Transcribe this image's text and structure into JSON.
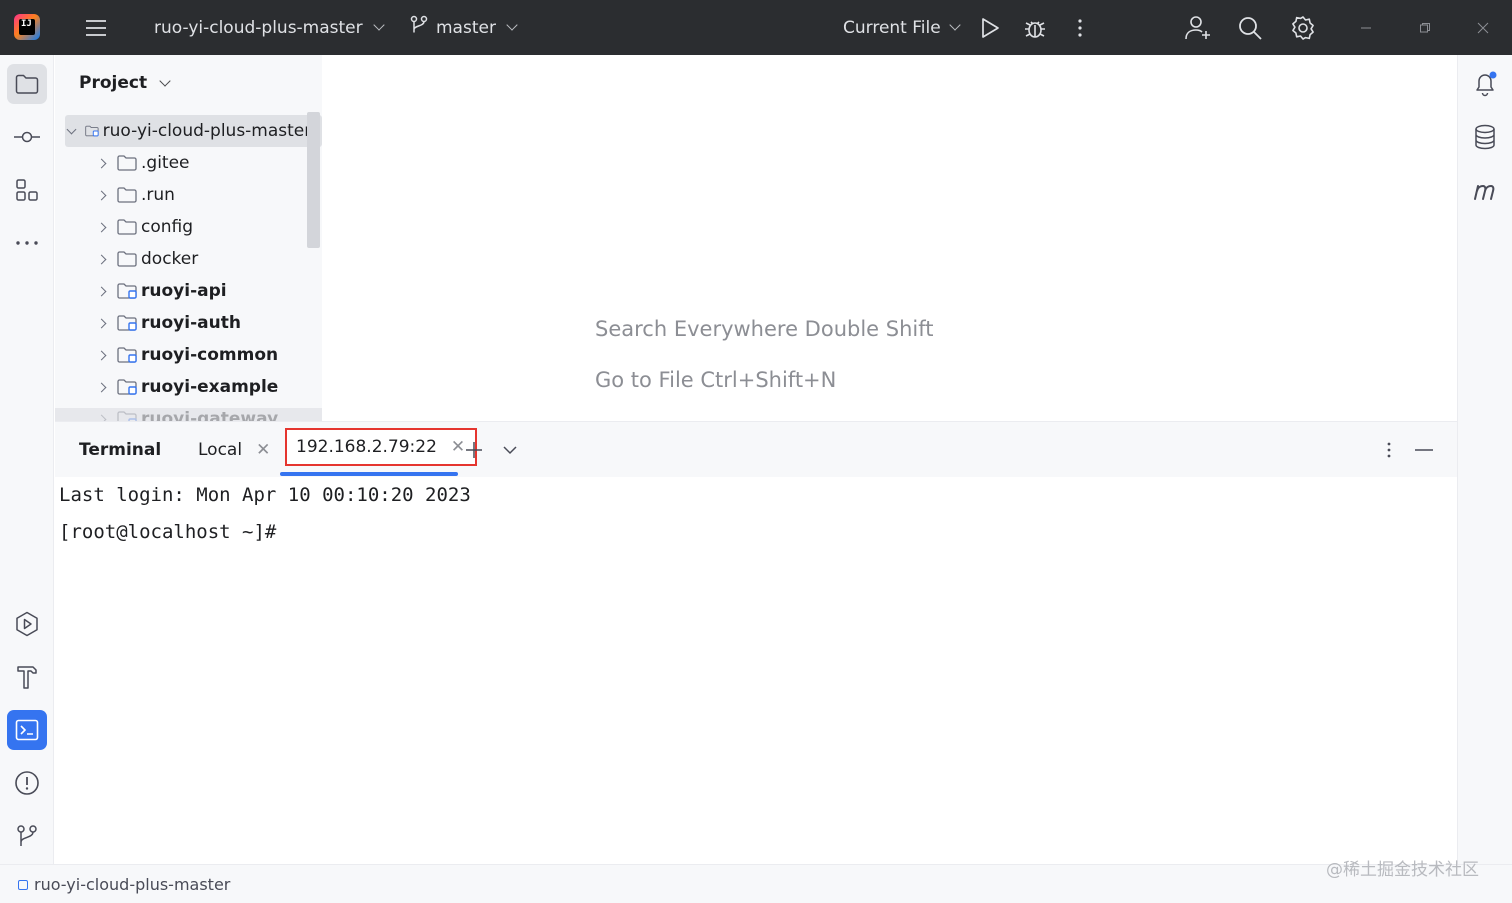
{
  "titlebar": {
    "project_name": "ruo-yi-cloud-plus-master",
    "branch": "master",
    "run_config": "Current File",
    "logo_text": "IJ"
  },
  "project_panel": {
    "title": "Project",
    "root": {
      "name": "ruo-yi-cloud-plus-master",
      "suffix": "|"
    },
    "items": [
      {
        "name": ".gitee",
        "bold": false,
        "module": false
      },
      {
        "name": ".run",
        "bold": false,
        "module": false
      },
      {
        "name": "config",
        "bold": false,
        "module": false
      },
      {
        "name": "docker",
        "bold": false,
        "module": false
      },
      {
        "name": "ruoyi-api",
        "bold": true,
        "module": true
      },
      {
        "name": "ruoyi-auth",
        "bold": true,
        "module": true
      },
      {
        "name": "ruoyi-common",
        "bold": true,
        "module": true
      },
      {
        "name": "ruoyi-example",
        "bold": true,
        "module": true
      },
      {
        "name": "ruoyi-gateway",
        "bold": true,
        "module": true
      }
    ]
  },
  "editor": {
    "hint_search": "Search Everywhere Double Shift",
    "hint_goto": "Go to File Ctrl+Shift+N"
  },
  "terminal": {
    "title": "Terminal",
    "tabs": [
      {
        "label": "Local",
        "active": false
      },
      {
        "label": "192.168.2.79:22",
        "active": true
      }
    ],
    "lines": [
      "Last login: Mon Apr 10 00:10:20 2023",
      "[root@localhost ~]#"
    ]
  },
  "statusbar": {
    "path": "ruo-yi-cloud-plus-master"
  },
  "watermark": "@稀土掘金技术社区",
  "colors": {
    "titlebar_bg": "#2b2d30",
    "accent": "#3574f0",
    "highlight_border": "#e5352f",
    "panel_bg": "#f7f8fa"
  }
}
